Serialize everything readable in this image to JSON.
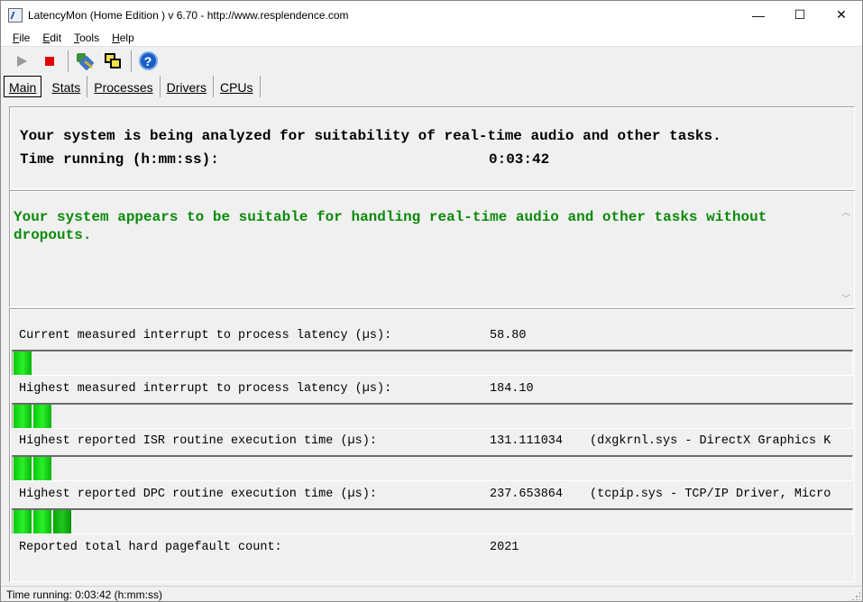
{
  "window": {
    "title": "LatencyMon  (Home Edition )  v 6.70 - http://www.resplendence.com",
    "minimize_glyph": "—",
    "maximize_glyph": "☐",
    "close_glyph": "✕"
  },
  "menu": [
    {
      "accel": "F",
      "rest": "ile"
    },
    {
      "accel": "E",
      "rest": "dit"
    },
    {
      "accel": "T",
      "rest": "ools"
    },
    {
      "accel": "H",
      "rest": "elp"
    }
  ],
  "toolbar": {
    "icons": [
      "play-icon",
      "stop-icon",
      "wand-icon",
      "windows-icon",
      "help-icon"
    ],
    "help_glyph": "?",
    "colors": {
      "stop": "#e00000",
      "play_disabled": "#9a9a9a",
      "help": "#1a5fc4"
    }
  },
  "tabs": [
    "Main",
    "Stats",
    "Processes",
    "Drivers",
    "CPUs"
  ],
  "main": {
    "analysis_line": "Your system is being analyzed for suitability of real-time audio and other tasks.",
    "time_running_label": "Time running (h:mm:ss):",
    "time_running_value": "0:03:42",
    "verdict": "Your system appears to be suitable for handling real-time audio and other tasks without dropouts.",
    "verdict_color": "#0a8a0a",
    "metrics": [
      {
        "label": "Current measured interrupt to process latency (µs):",
        "value": "58.80",
        "extra": "",
        "bar_segments": 1
      },
      {
        "label": "Highest measured interrupt to process latency (µs):",
        "value": "184.10",
        "extra": "",
        "bar_segments": 2
      },
      {
        "label": "Highest reported ISR routine execution time (µs):",
        "value": "131.111034",
        "extra": "(dxgkrnl.sys - DirectX Graphics K",
        "bar_segments": 2
      },
      {
        "label": "Highest reported DPC routine execution time (µs):",
        "value": "237.653864",
        "extra": "(tcpip.sys - TCP/IP Driver, Micro",
        "bar_segments": 3
      },
      {
        "label": "Reported total hard pagefault count:",
        "value": "2021",
        "extra": ""
      }
    ],
    "bar_color": "#07c807"
  },
  "status": {
    "text": "Time running: 0:03:42  (h:mm:ss)"
  }
}
